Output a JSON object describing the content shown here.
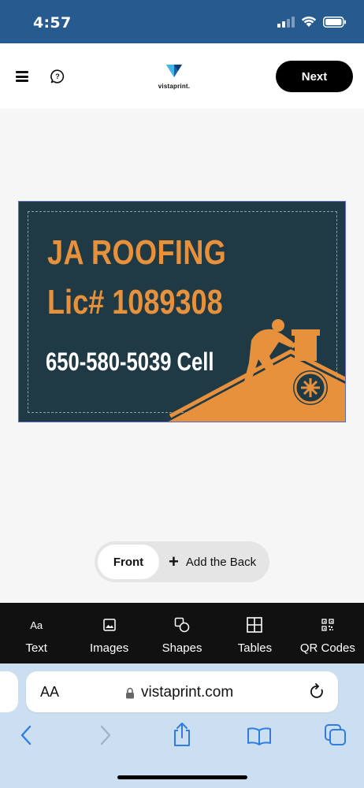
{
  "status": {
    "time": "4:57"
  },
  "header": {
    "brand": "vistaprint.",
    "next_label": "Next",
    "icons": [
      "menu-icon",
      "help-icon",
      "vistaprint-logo"
    ]
  },
  "card": {
    "line1": "JA ROOFING",
    "line2": "Lic# 1089308",
    "line3": "650-580-5039 Cell",
    "colors": {
      "background": "#1f3a44",
      "accent": "#e8913d",
      "text": "#ffffff"
    }
  },
  "sides": {
    "front_label": "Front",
    "add_back_label": "Add the Back"
  },
  "tools": [
    {
      "label": "Text",
      "icon": "text-icon"
    },
    {
      "label": "Images",
      "icon": "image-icon"
    },
    {
      "label": "Shapes",
      "icon": "shapes-icon"
    },
    {
      "label": "Tables",
      "icon": "table-icon"
    },
    {
      "label": "QR Codes",
      "icon": "qr-code-icon"
    }
  ],
  "browser": {
    "aa_label": "AA",
    "url": "vistaprint.com"
  },
  "colors": {
    "status_bar": "#275a8e",
    "toolbar": "#111111",
    "safari": "#cbdff0",
    "link_blue": "#2f7de1"
  }
}
